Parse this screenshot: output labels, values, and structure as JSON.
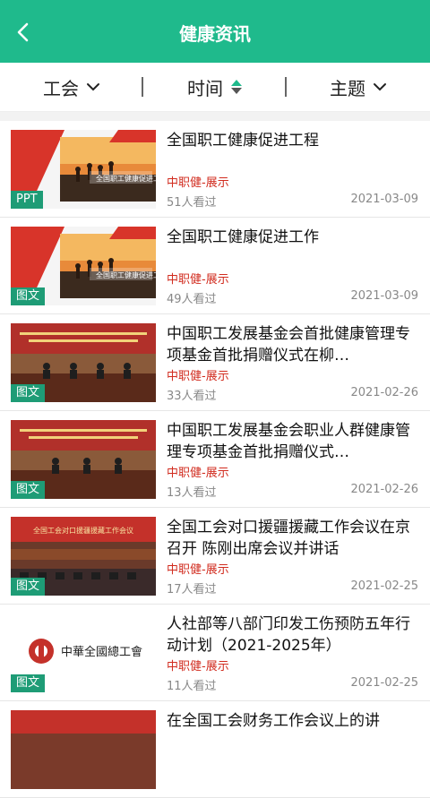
{
  "header": {
    "title": "健康资讯"
  },
  "filters": [
    {
      "label": "工会",
      "icon": "chevron-down-icon"
    },
    {
      "label": "时间",
      "icon": "sort-icon"
    },
    {
      "label": "主题",
      "icon": "chevron-down-icon"
    }
  ],
  "colors": {
    "accent": "#1fba8c",
    "tag": "#1e9c76",
    "source": "#d12b1e"
  },
  "items": [
    {
      "title": "全国职工健康促进工程",
      "tag": "PPT",
      "source": "中职健-展示",
      "views": "51人看过",
      "date": "2021-03-09",
      "thumb_text": "全国职工健康促进工程"
    },
    {
      "title": "全国职工健康促进工作",
      "tag": "图文",
      "source": "中职健-展示",
      "views": "49人看过",
      "date": "2021-03-09",
      "thumb_text": "全国职工健康促进工程"
    },
    {
      "title": "中国职工发展基金会首批健康管理专项基金首批捐赠仪式在柳…",
      "tag": "图文",
      "source": "中职健-展示",
      "views": "33人看过",
      "date": "2021-02-26"
    },
    {
      "title": "中国职工发展基金会职业人群健康管理专项基金首批捐赠仪式…",
      "tag": "图文",
      "source": "中职健-展示",
      "views": "13人看过",
      "date": "2021-02-26"
    },
    {
      "title": " 全国工会对口援疆援藏工作会议在京召开 陈刚出席会议并讲话",
      "tag": "图文",
      "source": "中职健-展示",
      "views": "17人看过",
      "date": "2021-02-25",
      "thumb_text": "全国工会对口援疆援藏工作会议"
    },
    {
      "title": "人社部等八部门印发工伤预防五年行动计划（2021-2025年）",
      "tag": "图文",
      "source": "中职健-展示",
      "views": "11人看过",
      "date": "2021-02-25",
      "thumb_text": "中華全國總工會"
    },
    {
      "title": "在全国工会财务工作会议上的讲"
    }
  ]
}
